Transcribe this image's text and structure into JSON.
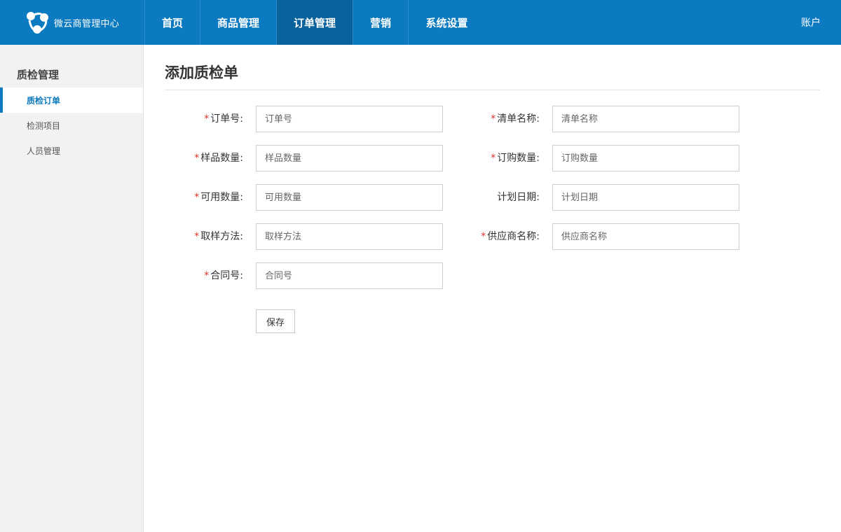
{
  "app": {
    "title": "微云商管理中心"
  },
  "nav": {
    "items": [
      {
        "label": "首页"
      },
      {
        "label": "商品管理"
      },
      {
        "label": "订单管理"
      },
      {
        "label": "营销"
      },
      {
        "label": "系统设置"
      }
    ],
    "active": "订单管理",
    "account": "账户"
  },
  "sidebar": {
    "title": "质检管理",
    "items": [
      {
        "label": "质检订单"
      },
      {
        "label": "检测项目"
      },
      {
        "label": "人员管理"
      }
    ],
    "active": "质检订单"
  },
  "main": {
    "title": "添加质检单",
    "fields": [
      {
        "label": "订单号:",
        "required": true,
        "placeholder": "订单号"
      },
      {
        "label": "清单名称:",
        "required": true,
        "placeholder": "清单名称"
      },
      {
        "label": "样品数量:",
        "required": true,
        "placeholder": "样品数量"
      },
      {
        "label": "订购数量:",
        "required": true,
        "placeholder": "订购数量"
      },
      {
        "label": "可用数量:",
        "required": true,
        "placeholder": "可用数量"
      },
      {
        "label": "计划日期:",
        "required": false,
        "placeholder": "计划日期"
      },
      {
        "label": "取样方法:",
        "required": true,
        "placeholder": "取样方法"
      },
      {
        "label": "供应商名称:",
        "required": true,
        "placeholder": "供应商名称"
      },
      {
        "label": "合同号:",
        "required": true,
        "placeholder": "合同号"
      }
    ],
    "required_mark": "*",
    "save_label": "保存"
  },
  "colors": {
    "brand": "#0b7ac0",
    "nav_active": "#0a629c",
    "required": "#d9322c"
  }
}
